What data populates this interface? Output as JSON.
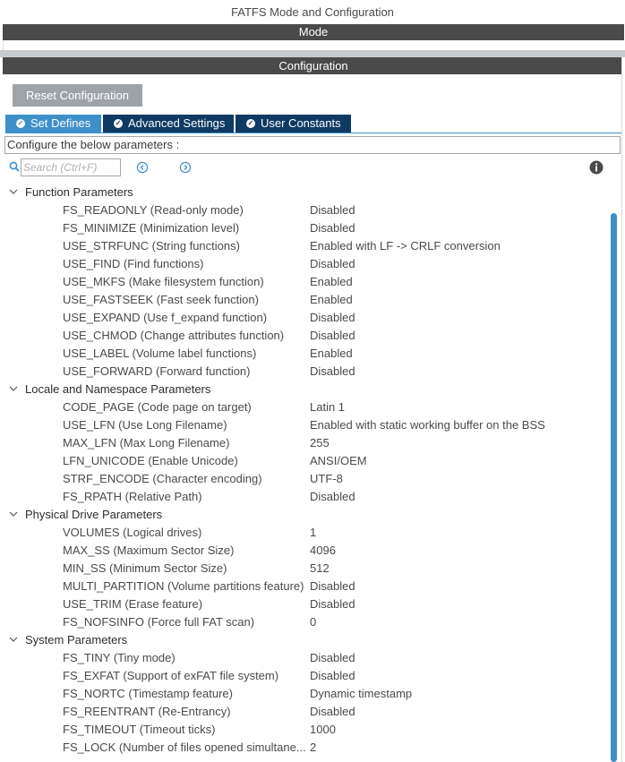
{
  "window_title": "FATFS Mode and Configuration",
  "mode_header": "Mode",
  "config_header": "Configuration",
  "reset_button": "Reset Configuration",
  "tabs": [
    {
      "label": "Set Defines",
      "active": true
    },
    {
      "label": "Advanced Settings",
      "active": false
    },
    {
      "label": "User Constants",
      "active": false
    }
  ],
  "description": "Configure the below parameters :",
  "search": {
    "placeholder": "Search (Ctrl+F)",
    "value": ""
  },
  "icons": {
    "search": "search-icon",
    "prev": "circle-chevron-left-icon",
    "next": "circle-chevron-right-icon",
    "info": "info-icon",
    "check": "check-circle-icon",
    "expand": "chevron-down-icon"
  },
  "colors": {
    "header_bar": "#4a4a4a",
    "active_tab": "#3e90c9",
    "inactive_tab": "#0e3a63",
    "reset_button": "#9ea3a8",
    "scrollbar": "#3e90c9",
    "nav_icon": "#3e90c9"
  },
  "groups": [
    {
      "name": "Function Parameters",
      "params": [
        {
          "name": "FS_READONLY (Read-only mode)",
          "value": "Disabled"
        },
        {
          "name": "FS_MINIMIZE (Minimization level)",
          "value": "Disabled"
        },
        {
          "name": "USE_STRFUNC (String functions)",
          "value": "Enabled with LF -> CRLF conversion"
        },
        {
          "name": "USE_FIND (Find functions)",
          "value": "Disabled"
        },
        {
          "name": "USE_MKFS (Make filesystem function)",
          "value": "Enabled"
        },
        {
          "name": "USE_FASTSEEK (Fast seek function)",
          "value": "Enabled"
        },
        {
          "name": "USE_EXPAND (Use f_expand function)",
          "value": "Disabled"
        },
        {
          "name": "USE_CHMOD (Change attributes function)",
          "value": "Disabled"
        },
        {
          "name": "USE_LABEL (Volume label functions)",
          "value": "Enabled"
        },
        {
          "name": "USE_FORWARD (Forward function)",
          "value": "Disabled"
        }
      ]
    },
    {
      "name": "Locale and Namespace Parameters",
      "params": [
        {
          "name": "CODE_PAGE (Code page on target)",
          "value": "Latin 1"
        },
        {
          "name": "USE_LFN (Use Long Filename)",
          "value": "Enabled with static working buffer on the BSS"
        },
        {
          "name": "MAX_LFN (Max Long Filename)",
          "value": "255"
        },
        {
          "name": "LFN_UNICODE (Enable Unicode)",
          "value": "ANSI/OEM"
        },
        {
          "name": "STRF_ENCODE (Character encoding)",
          "value": "UTF-8"
        },
        {
          "name": "FS_RPATH (Relative Path)",
          "value": "Disabled"
        }
      ]
    },
    {
      "name": "Physical Drive Parameters",
      "params": [
        {
          "name": "VOLUMES (Logical drives)",
          "value": "1"
        },
        {
          "name": "MAX_SS (Maximum Sector Size)",
          "value": "4096"
        },
        {
          "name": "MIN_SS (Minimum Sector Size)",
          "value": "512"
        },
        {
          "name": "MULTI_PARTITION (Volume partitions feature)",
          "value": "Disabled"
        },
        {
          "name": "USE_TRIM (Erase feature)",
          "value": "Disabled"
        },
        {
          "name": "FS_NOFSINFO (Force full FAT scan)",
          "value": "0"
        }
      ]
    },
    {
      "name": "System Parameters",
      "params": [
        {
          "name": "FS_TINY (Tiny mode)",
          "value": "Disabled"
        },
        {
          "name": "FS_EXFAT (Support of exFAT file system)",
          "value": "Disabled"
        },
        {
          "name": "FS_NORTC (Timestamp feature)",
          "value": "Dynamic timestamp"
        },
        {
          "name": "FS_REENTRANT (Re-Entrancy)",
          "value": "Disabled"
        },
        {
          "name": "FS_TIMEOUT (Timeout ticks)",
          "value": "1000"
        },
        {
          "name": "FS_LOCK (Number of files opened simultane...",
          "value": "2"
        }
      ]
    }
  ]
}
